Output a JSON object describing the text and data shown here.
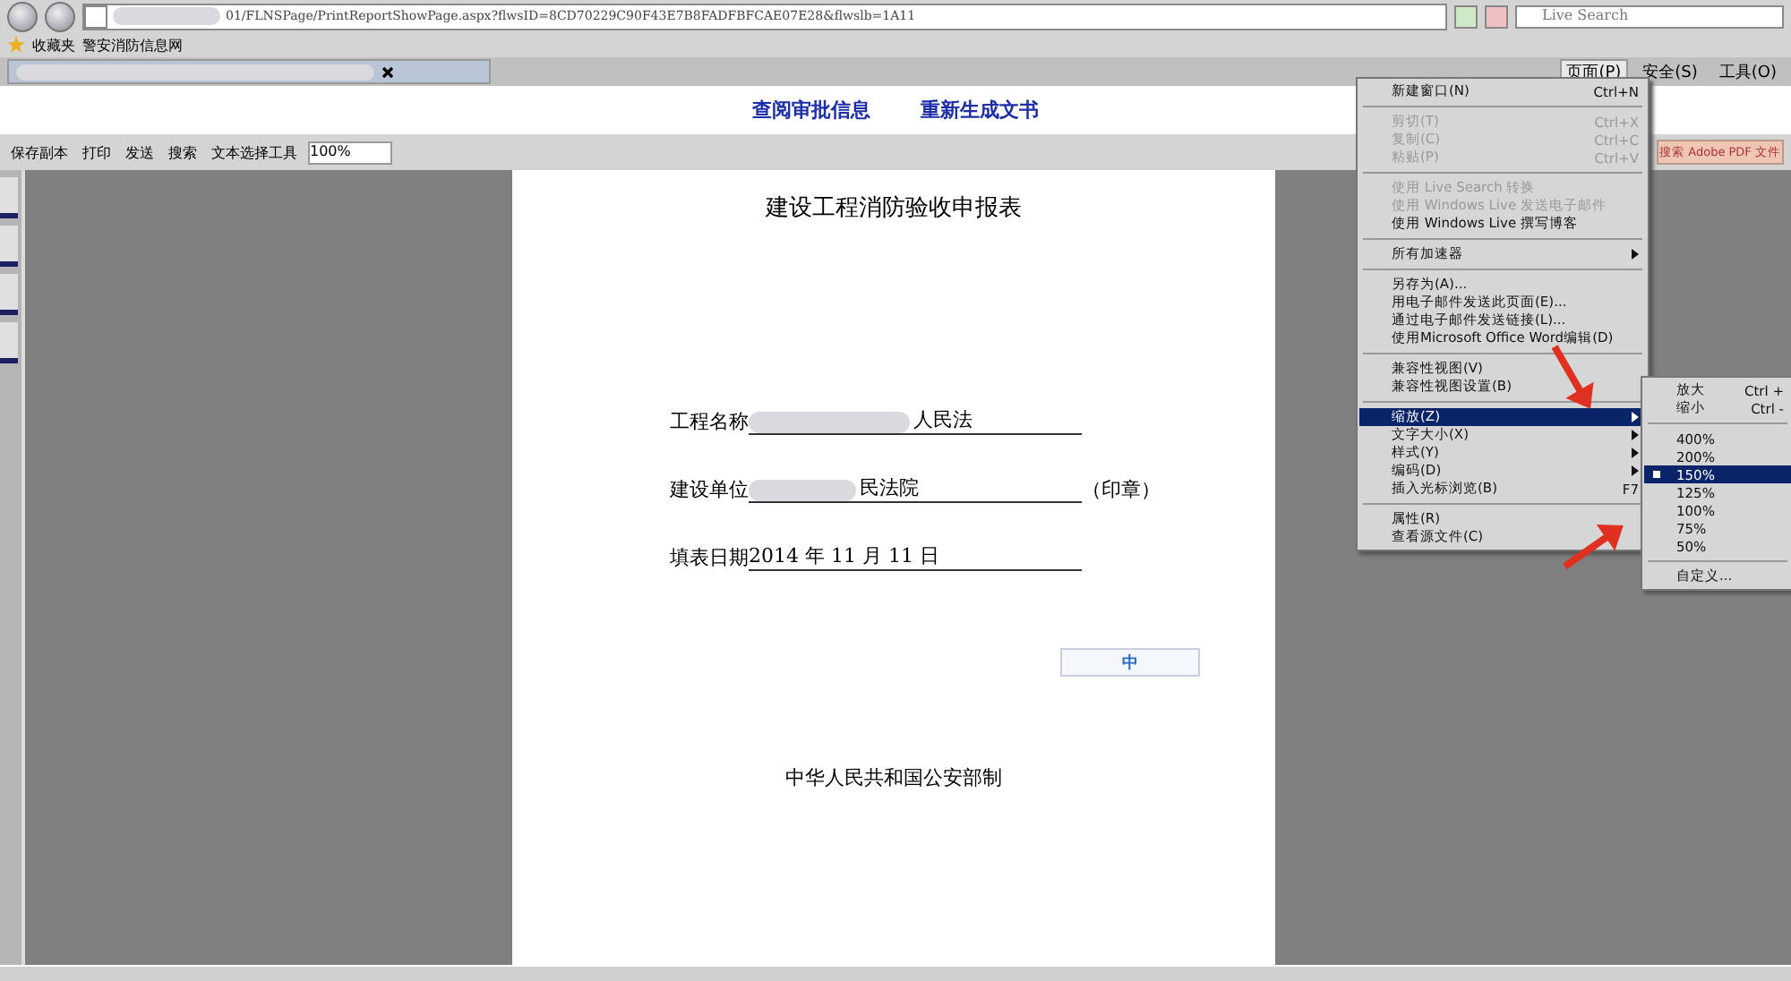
{
  "address_bar": {
    "url": "01/FLNSPage/PrintReportShowPage.aspx?flwsID=8CD70229C90F43E7B8FADFBFCAE07E28&flwslb=1A11",
    "search_placeholder": "Live Search"
  },
  "favorites_bar": {
    "label": "收藏夹",
    "items": [
      "警安消防信息网"
    ]
  },
  "command_bar": {
    "items": [
      {
        "label": "页面(P)",
        "selected": true
      },
      {
        "label": "安全(S)",
        "selected": false
      },
      {
        "label": "工具(O)",
        "selected": false
      }
    ]
  },
  "page_links": [
    "查阅审批信息",
    "重新生成文书"
  ],
  "pdf_toolbar": {
    "buttons": [
      "保存副本",
      "打印",
      "发送",
      "搜索"
    ],
    "select_tool": "文本选择工具",
    "zoom": "100%",
    "search_pdf": "搜索 Adobe PDF 文件"
  },
  "document": {
    "title": "建设工程消防验收申报表",
    "fields": [
      {
        "label": "工程名称",
        "value": "人民法"
      },
      {
        "label": "建设单位",
        "value": "民法院",
        "after": "（印章）"
      },
      {
        "label": "填表日期",
        "value": "2014 年 11 月 11 日"
      }
    ],
    "footer": "中华人民共和国公安部制",
    "ime_label": "中"
  },
  "page_menu": {
    "items": [
      {
        "kind": "item",
        "label": "新建窗口(N)",
        "shortcut": "Ctrl+N",
        "disabled": false,
        "submenu": false,
        "selected": false
      },
      {
        "kind": "separator"
      },
      {
        "kind": "item",
        "label": "剪切(T)",
        "shortcut": "Ctrl+X",
        "disabled": true,
        "submenu": false,
        "selected": false
      },
      {
        "kind": "item",
        "label": "复制(C)",
        "shortcut": "Ctrl+C",
        "disabled": true,
        "submenu": false,
        "selected": false
      },
      {
        "kind": "item",
        "label": "粘贴(P)",
        "shortcut": "Ctrl+V",
        "disabled": true,
        "submenu": false,
        "selected": false
      },
      {
        "kind": "separator"
      },
      {
        "kind": "item",
        "label": "使用 Live Search 转换",
        "disabled": true,
        "submenu": false,
        "selected": false
      },
      {
        "kind": "item",
        "label": "使用 Windows Live 发送电子邮件",
        "disabled": true,
        "submenu": false,
        "selected": false
      },
      {
        "kind": "item",
        "label": "使用 Windows Live 撰写博客",
        "disabled": false,
        "submenu": false,
        "selected": false
      },
      {
        "kind": "separator"
      },
      {
        "kind": "item",
        "label": "所有加速器",
        "disabled": false,
        "submenu": true,
        "selected": false
      },
      {
        "kind": "separator"
      },
      {
        "kind": "item",
        "label": "另存为(A)...",
        "disabled": false,
        "submenu": false,
        "selected": false
      },
      {
        "kind": "item",
        "label": "用电子邮件发送此页面(E)...",
        "disabled": false,
        "submenu": false,
        "selected": false
      },
      {
        "kind": "item",
        "label": "通过电子邮件发送链接(L)...",
        "disabled": false,
        "submenu": false,
        "selected": false
      },
      {
        "kind": "item",
        "label": "使用Microsoft Office Word编辑(D)",
        "disabled": false,
        "submenu": false,
        "selected": false
      },
      {
        "kind": "separator"
      },
      {
        "kind": "item",
        "label": "兼容性视图(V)",
        "disabled": false,
        "submenu": false,
        "selected": false
      },
      {
        "kind": "item",
        "label": "兼容性视图设置(B)",
        "disabled": false,
        "submenu": false,
        "selected": false
      },
      {
        "kind": "separator"
      },
      {
        "kind": "item",
        "label": "缩放(Z)",
        "disabled": false,
        "submenu": true,
        "selected": true
      },
      {
        "kind": "item",
        "label": "文字大小(X)",
        "disabled": false,
        "submenu": true,
        "selected": false
      },
      {
        "kind": "item",
        "label": "样式(Y)",
        "disabled": false,
        "submenu": true,
        "selected": false
      },
      {
        "kind": "item",
        "label": "编码(D)",
        "disabled": false,
        "submenu": true,
        "selected": false
      },
      {
        "kind": "item",
        "label": "插入光标浏览(B)",
        "shortcut": "F7",
        "disabled": false,
        "submenu": false,
        "selected": false
      },
      {
        "kind": "separator"
      },
      {
        "kind": "item",
        "label": "属性(R)",
        "disabled": false,
        "submenu": false,
        "selected": false
      },
      {
        "kind": "item",
        "label": "查看源文件(C)",
        "disabled": false,
        "submenu": false,
        "selected": false
      }
    ]
  },
  "zoom_menu": {
    "items": [
      {
        "kind": "item",
        "label": "放大",
        "shortcut": "Ctrl +",
        "selected": false
      },
      {
        "kind": "item",
        "label": "缩小",
        "shortcut": "Ctrl -",
        "selected": false
      },
      {
        "kind": "separator"
      },
      {
        "kind": "item",
        "label": "400%",
        "selected": false
      },
      {
        "kind": "item",
        "label": "200%",
        "selected": false
      },
      {
        "kind": "item",
        "label": "150%",
        "selected": true
      },
      {
        "kind": "item",
        "label": "125%",
        "selected": false
      },
      {
        "kind": "item",
        "label": "100%",
        "selected": false
      },
      {
        "kind": "item",
        "label": "75%",
        "selected": false
      },
      {
        "kind": "item",
        "label": "50%",
        "selected": false
      },
      {
        "kind": "separator"
      },
      {
        "kind": "item",
        "label": "自定义...",
        "selected": false
      }
    ]
  }
}
